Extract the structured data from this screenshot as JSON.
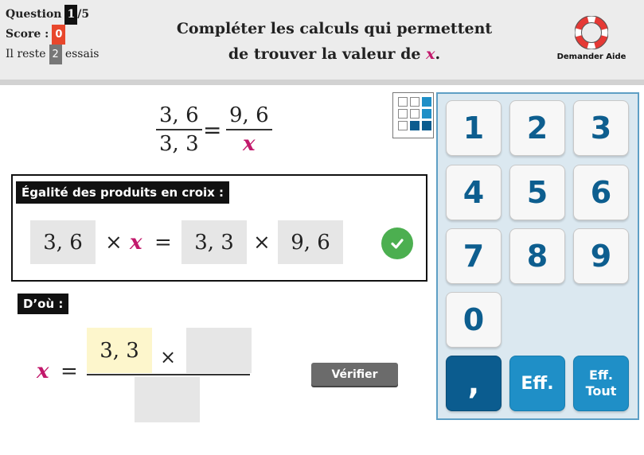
{
  "header": {
    "question_label": "Question",
    "question_current": "1",
    "question_total": "/5",
    "score_label": "Score :",
    "score_value": "0",
    "remaining_prefix": "Il reste",
    "remaining_count": "2",
    "remaining_suffix": "essais",
    "instruction_line1": "Compléter les calculs qui permettent",
    "instruction_line2_prefix": "de trouver la valeur de",
    "instruction_var": "x",
    "instruction_line2_suffix": ".",
    "help_label": "Demander Aide"
  },
  "equation": {
    "left_num": "3, 6",
    "left_den": "3, 3",
    "equals": "=",
    "right_num": "9, 6",
    "right_den": "x"
  },
  "cross_product": {
    "title": "Égalité des produits en croix :",
    "cell1": "3, 6",
    "times1": "×",
    "var": "x",
    "equals": "=",
    "cell2": "3, 3",
    "times2": "×",
    "cell3": "9, 6"
  },
  "result": {
    "title": "D’où :",
    "var": "x",
    "equals": "=",
    "num_cell1": "3, 3",
    "times": "×",
    "num_cell2": "",
    "den_cell": ""
  },
  "buttons": {
    "verify": "Vérifier"
  },
  "keypad": {
    "keys": [
      "1",
      "2",
      "3",
      "4",
      "5",
      "6",
      "7",
      "8",
      "9",
      "0"
    ],
    "comma": ",",
    "erase": "Eff.",
    "erase_all_line1": "Eff.",
    "erase_all_line2": "Tout"
  },
  "colors": {
    "accent_magenta": "#c2186b",
    "keypad_blue": "#1f8fc7",
    "keypad_dark": "#0b5c8f",
    "success_green": "#4caf50",
    "score_red": "#e8472c"
  }
}
